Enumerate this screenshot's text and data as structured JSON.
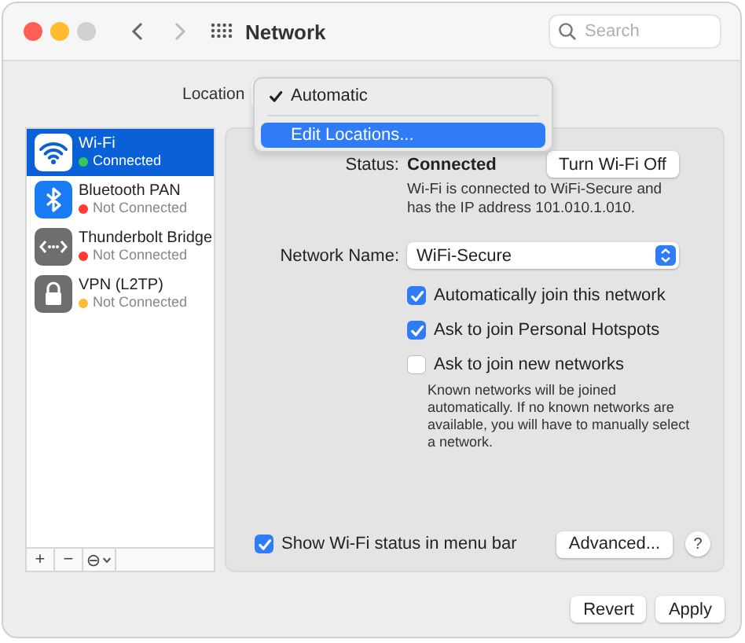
{
  "window": {
    "title": "Network",
    "search": {
      "placeholder": "Search"
    }
  },
  "location": {
    "label": "Location",
    "menu": [
      {
        "label": "Automatic",
        "checked": true,
        "selected": false
      },
      {
        "label": "Edit Locations...",
        "checked": false,
        "selected": true
      }
    ]
  },
  "services": [
    {
      "name": "Wi-Fi",
      "status": "Connected",
      "color": "#34c759",
      "kind": "wifi",
      "selected": true
    },
    {
      "name": "Bluetooth PAN",
      "status": "Not Connected",
      "color": "#ff3b30",
      "kind": "bluetooth",
      "selected": false
    },
    {
      "name": "Thunderbolt Bridge",
      "status": "Not Connected",
      "color": "#ff3b30",
      "kind": "thunderbolt",
      "selected": false
    },
    {
      "name": "VPN (L2TP)",
      "status": "Not Connected",
      "color": "#febc2e",
      "kind": "vpn",
      "selected": false
    }
  ],
  "service_tools": [
    {
      "label": "+",
      "kind": "add"
    },
    {
      "label": "−",
      "kind": "remove"
    },
    {
      "label": "⊖",
      "kind": "actions"
    }
  ],
  "status": {
    "label": "Status:",
    "value": "Connected",
    "button": "Turn Wi-Fi Off",
    "description": "Wi-Fi is connected to WiFi-Secure and has the IP address 101.010.1.010."
  },
  "network_name": {
    "label": "Network Name:",
    "value": "WiFi-Secure"
  },
  "options": [
    {
      "label": "Automatically join this network",
      "checked": true
    },
    {
      "label": "Ask to join Personal Hotspots",
      "checked": true
    },
    {
      "label": "Ask to join new networks",
      "checked": false
    }
  ],
  "note": "Known networks will be joined automatically. If no known networks are available, you will have to manually select a network.",
  "menu_bar_option": {
    "label": "Show Wi-Fi status in menu bar",
    "checked": true
  },
  "advanced_button": "Advanced...",
  "help_button": "?",
  "buttons": [
    "Revert",
    "Apply"
  ]
}
